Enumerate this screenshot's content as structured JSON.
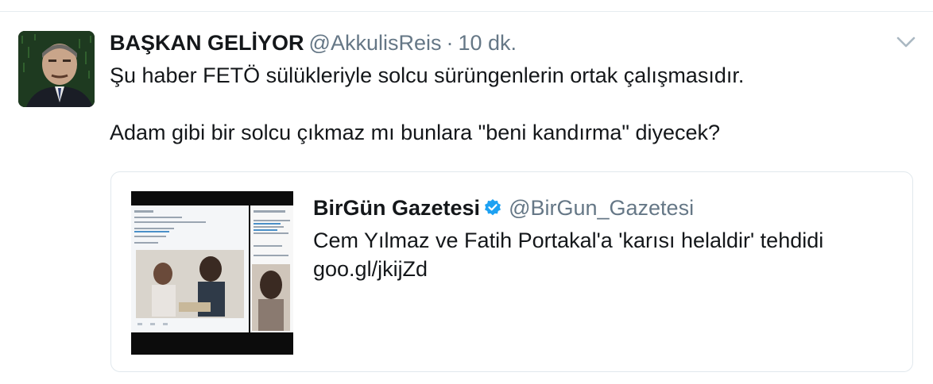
{
  "tweet": {
    "display_name": "BAŞKAN GELİYOR",
    "handle": "@AkkulisReis",
    "separator": "·",
    "time": "10 dk.",
    "text": "Şu haber FETÖ sülükleriyle solcu sürüngenlerin ortak çalışmasıdır.\n\nAdam gibi bir solcu çıkmaz mı bunlara \"beni kandırma\" diyecek?",
    "quoted": {
      "display_name": "BirGün Gazetesi",
      "verified": true,
      "handle": "@BirGun_Gazetesi",
      "text": "Cem Yılmaz ve Fatih Portakal'a 'karısı helaldir' tehdidi\ngoo.gl/jkijZd"
    }
  },
  "colors": {
    "text": "#14171a",
    "secondary": "#657786",
    "border": "#e1e8ed",
    "verified": "#1da1f2"
  }
}
